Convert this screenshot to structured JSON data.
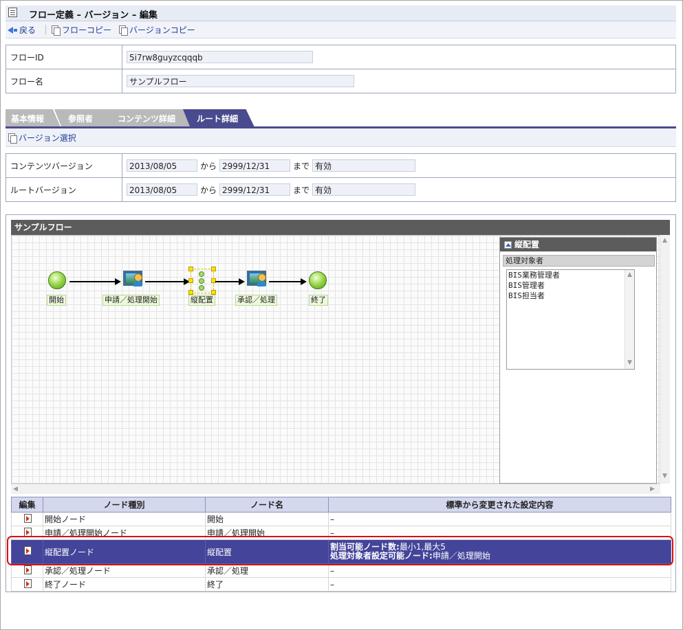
{
  "page": {
    "title": "フロー定義 – バージョン – 編集"
  },
  "toolbar": {
    "back": "戻る",
    "flow_copy": "フローコピー",
    "version_copy": "バージョンコピー"
  },
  "form1": {
    "flow_id_label": "フローID",
    "flow_id_value": "5i7rw8guyzcqqqb",
    "flow_name_label": "フロー名",
    "flow_name_value": "サンプルフロー"
  },
  "tabs": [
    "基本情報",
    "参照者",
    "コンテンツ詳細",
    "ルート詳細"
  ],
  "active_tab": "ルート詳細",
  "version_select": "バージョン選択",
  "form2": {
    "content_version_label": "コンテンツバージョン",
    "route_version_label": "ルートバージョン",
    "from": "から",
    "until": "まで",
    "content_start": "2013/08/05",
    "content_end": "2999/12/31",
    "content_status": "有効",
    "route_start": "2013/08/05",
    "route_end": "2999/12/31",
    "route_status": "有効"
  },
  "panel": {
    "title": "サンプルフロー"
  },
  "nodes": {
    "start": "開始",
    "apply": "申請／処理開始",
    "vertical": "縦配置",
    "approve": "承認／処理",
    "end": "終了"
  },
  "props": {
    "title": "縦配置",
    "section": "処理対象者",
    "list": [
      "BIS業務管理者",
      "BIS管理者",
      "BIS担当者"
    ]
  },
  "grid": {
    "headers": [
      "編集",
      "ノード種別",
      "ノード名",
      "標準から変更された設定内容"
    ],
    "rows": [
      {
        "type": "開始ノード",
        "name": "開始",
        "detail": "–"
      },
      {
        "type": "申請／処理開始ノード",
        "name": "申請／処理開始",
        "detail": "–"
      },
      {
        "type": "縦配置ノード",
        "name": "縦配置",
        "detail1_label": "割当可能ノード数:",
        "detail1_value": "最小1,最大5",
        "detail2_label": "処理対象者設定可能ノード:",
        "detail2_value": "申請／処理開始"
      },
      {
        "type": "承認／処理ノード",
        "name": "承認／処理",
        "detail": "–"
      },
      {
        "type": "終了ノード",
        "name": "終了",
        "detail": "–"
      }
    ]
  },
  "colors": {
    "accent": "#4a4a8e",
    "selected_row": "#44449a",
    "highlight": "#d80f0f",
    "node_label_bg": "#eef9dc"
  }
}
